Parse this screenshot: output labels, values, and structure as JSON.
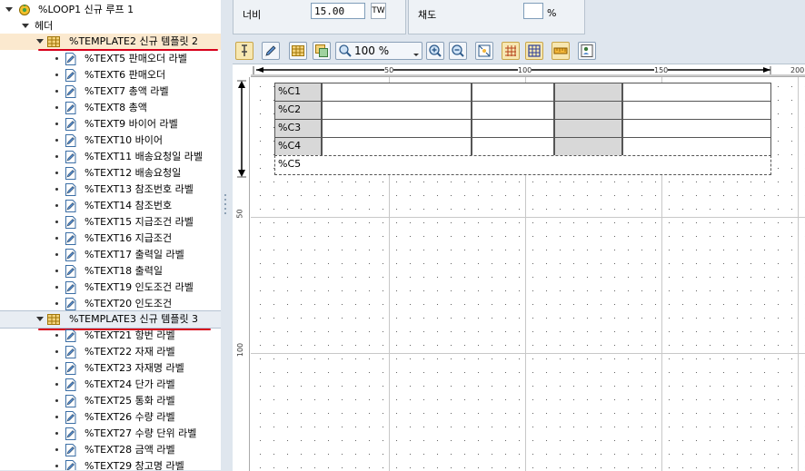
{
  "tree": {
    "loop": "%LOOP1 신규 루프 1",
    "header": "헤더",
    "template2": "%TEMPLATE2 신규 템플릿 2",
    "template3": "%TEMPLATE3 신규 템플릿 3",
    "items_t2": [
      "%TEXT5 판매오더 라벨",
      "%TEXT6 판매오더",
      "%TEXT7 총액 라벨",
      "%TEXT8 총액",
      "%TEXT9 바이어 라벨",
      "%TEXT10 바이어",
      "%TEXT11 배송요청일 라벨",
      "%TEXT12 배송요청일",
      "%TEXT13 참조번호 라벨",
      "%TEXT14 참조번호",
      "%TEXT15 지급조건 라벨",
      "%TEXT16 지급조건",
      "%TEXT17 출력일 라벨",
      "%TEXT18 출력일",
      "%TEXT19 인도조건 라벨",
      "%TEXT20 인도조건"
    ],
    "items_t3": [
      "%TEXT21 항번 라벨",
      "%TEXT22 자재 라벨",
      "%TEXT23 자재명 라벨",
      "%TEXT24 단가 라벨",
      "%TEXT25 통화 라벨",
      "%TEXT26 수량 라벨",
      "%TEXT27 수량 단위 라벨",
      "%TEXT28 금액 라벨",
      "%TEXT29 창고명 라벨"
    ]
  },
  "props": {
    "width_label": "너비",
    "width_value": "15.00",
    "width_unit": "TW",
    "saturation_label": "채도",
    "saturation_value": "",
    "saturation_unit": "%"
  },
  "toolbar": {
    "zoom": "100 %"
  },
  "ruler": {
    "h_ticks": [
      "50",
      "100",
      "150",
      "200"
    ],
    "v_ticks": [
      "50",
      "100"
    ]
  },
  "template_cells": [
    "%C1",
    "%C2",
    "%C3",
    "%C4",
    "%C5"
  ]
}
